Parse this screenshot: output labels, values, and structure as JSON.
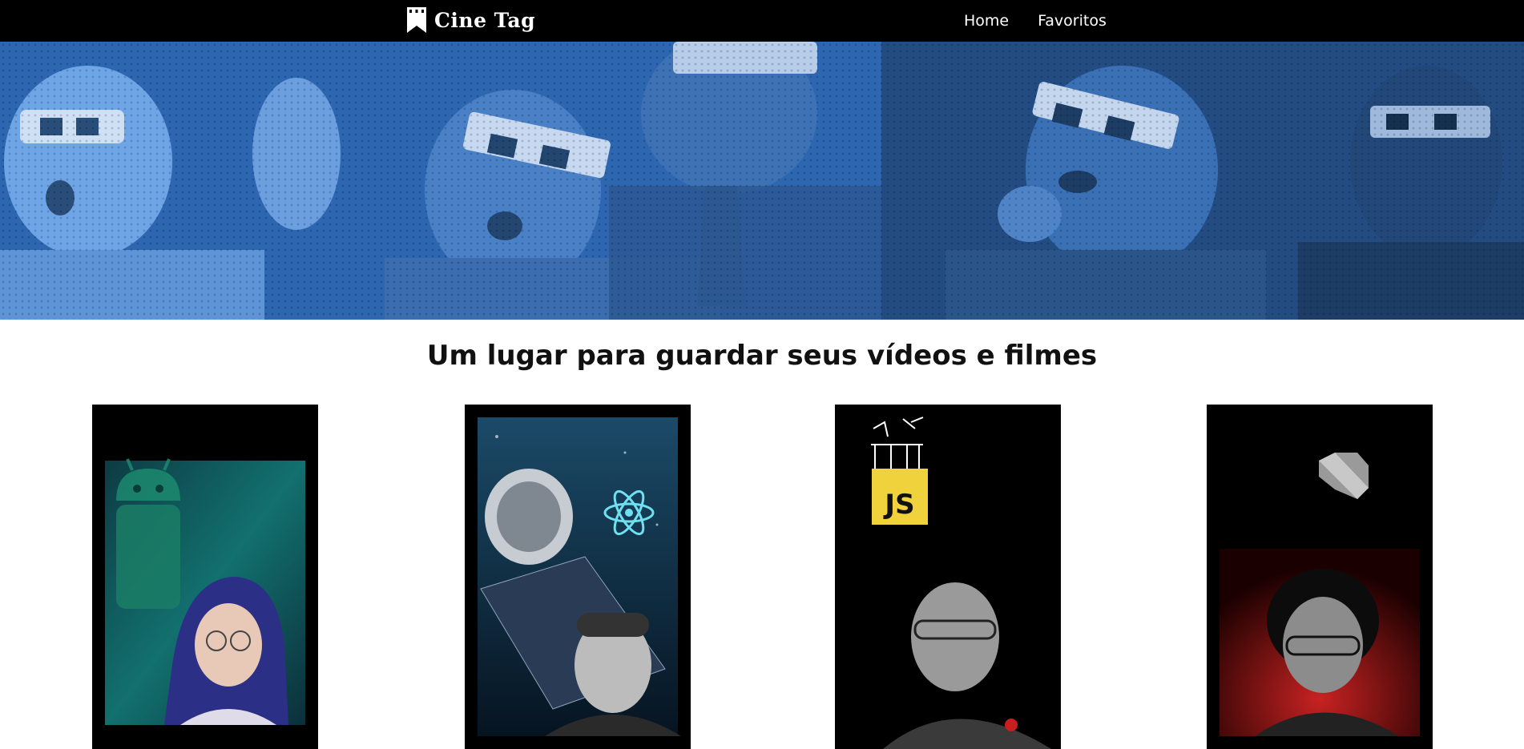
{
  "header": {
    "logo_text": "Cine Tag",
    "logo_icon": "bookmark-icon",
    "nav": [
      {
        "label": "Home"
      },
      {
        "label": "Favoritos"
      }
    ]
  },
  "banner": {
    "image": "cinema-audience-3d-glasses-banner",
    "tint_color": "#2f6cba"
  },
  "main": {
    "title": "Um lugar para guardar seus vídeos e filmes"
  },
  "cards": [
    {
      "thumbnail": "android-course-thumbnail",
      "icon": "android-icon",
      "accent": "#1fa59a"
    },
    {
      "thumbnail": "react-course-thumbnail",
      "icon": "react-icon",
      "accent": "#5fd0e0"
    },
    {
      "thumbnail": "javascript-course-thumbnail",
      "badge": "JS",
      "accent": "#f0d23c"
    },
    {
      "thumbnail": "dart-course-thumbnail",
      "icon": "dart-icon",
      "accent": "#b51c1c"
    }
  ]
}
